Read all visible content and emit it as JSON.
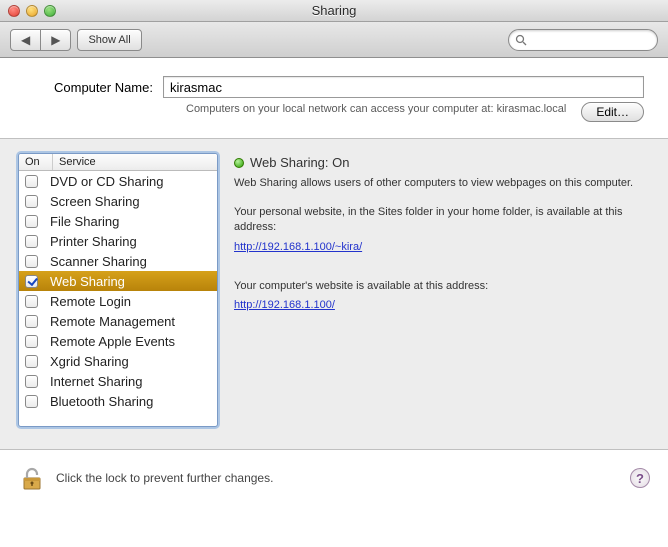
{
  "window": {
    "title": "Sharing"
  },
  "toolbar": {
    "showAll": "Show All",
    "searchPlaceholder": ""
  },
  "computerName": {
    "label": "Computer Name:",
    "value": "kirasmac",
    "description": "Computers on your local network can access your computer at: kirasmac.local",
    "editLabel": "Edit…"
  },
  "serviceList": {
    "headers": {
      "on": "On",
      "service": "Service"
    },
    "items": [
      {
        "label": "DVD or CD Sharing",
        "checked": false,
        "selected": false
      },
      {
        "label": "Screen Sharing",
        "checked": false,
        "selected": false
      },
      {
        "label": "File Sharing",
        "checked": false,
        "selected": false
      },
      {
        "label": "Printer Sharing",
        "checked": false,
        "selected": false
      },
      {
        "label": "Scanner Sharing",
        "checked": false,
        "selected": false
      },
      {
        "label": "Web Sharing",
        "checked": true,
        "selected": true
      },
      {
        "label": "Remote Login",
        "checked": false,
        "selected": false
      },
      {
        "label": "Remote Management",
        "checked": false,
        "selected": false
      },
      {
        "label": "Remote Apple Events",
        "checked": false,
        "selected": false
      },
      {
        "label": "Xgrid Sharing",
        "checked": false,
        "selected": false
      },
      {
        "label": "Internet Sharing",
        "checked": false,
        "selected": false
      },
      {
        "label": "Bluetooth Sharing",
        "checked": false,
        "selected": false
      }
    ]
  },
  "details": {
    "statusTitle": "Web Sharing: On",
    "statusDesc": "Web Sharing allows users of other computers to view webpages on this computer.",
    "personalText": "Your personal website, in the Sites folder in your home folder, is available at this address:",
    "personalUrl": "http://192.168.1.100/~kira/",
    "computerText": "Your computer's website is available at this address:",
    "computerUrl": "http://192.168.1.100/"
  },
  "lock": {
    "text": "Click the lock to prevent further changes."
  }
}
